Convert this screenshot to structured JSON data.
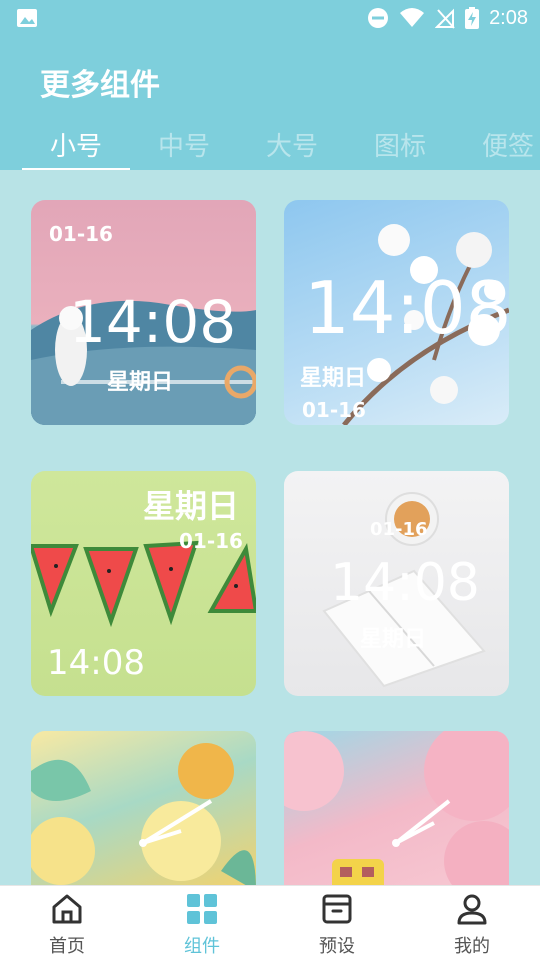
{
  "status": {
    "time": "2:08",
    "icons": [
      "image-icon",
      "dnd-icon",
      "wifi-icon",
      "no-signal-icon",
      "battery-charging-icon"
    ]
  },
  "header": {
    "title": "更多组件"
  },
  "tabs": [
    {
      "label": "小号",
      "active": true
    },
    {
      "label": "中号",
      "active": false
    },
    {
      "label": "大号",
      "active": false
    },
    {
      "label": "图标",
      "active": false
    },
    {
      "label": "便签",
      "active": false
    }
  ],
  "widgets": [
    {
      "date": "01-16",
      "time": "14:08",
      "weekday": "星期日"
    },
    {
      "date": "01-16",
      "time": "14:08",
      "weekday": "星期日"
    },
    {
      "date": "01-16",
      "time": "14:08",
      "weekday": "星期日"
    },
    {
      "date": "01-16",
      "time": "14:08",
      "weekday": "星期日"
    }
  ],
  "bottom_nav": [
    {
      "label": "首页",
      "icon": "home-icon",
      "active": false
    },
    {
      "label": "组件",
      "icon": "widgets-grid-icon",
      "active": true
    },
    {
      "label": "预设",
      "icon": "archive-box-icon",
      "active": false
    },
    {
      "label": "我的",
      "icon": "user-icon",
      "active": false
    }
  ],
  "colors": {
    "accent": "#5fc3d8",
    "header_bg": "#7ecfdc",
    "page_bg": "#b8e3e6"
  }
}
